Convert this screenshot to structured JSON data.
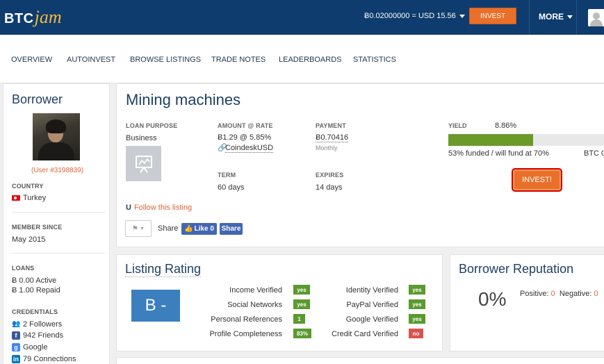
{
  "header": {
    "logo_btc": "BTC",
    "logo_jam": "jam",
    "rate": "Ƀ0.02000000 = USD 15.56",
    "invest_label": "INVEST",
    "more_label": "MORE"
  },
  "nav": {
    "items": [
      "OVERVIEW",
      "AUTOINVEST",
      "BROWSE LISTINGS",
      "TRADE NOTES",
      "LEADERBOARDS",
      "STATISTICS"
    ]
  },
  "borrower": {
    "title": "Borrower",
    "user": "(User #3198839)",
    "country_label": "COUNTRY",
    "country": "Turkey",
    "member_since_label": "MEMBER SINCE",
    "member_since": "May 2015",
    "loans_label": "LOANS",
    "loans_active": "Ƀ 0.00 Active",
    "loans_repaid": "Ƀ 1.00 Repaid",
    "credentials_label": "CREDENTIALS",
    "credentials": [
      "2 Followers",
      "942 Friends",
      "Google",
      "79 Connections"
    ]
  },
  "loan": {
    "title": "Mining machines",
    "purpose_label": "LOAN PURPOSE",
    "purpose": "Business",
    "amount_label": "AMOUNT @ RATE",
    "amount": "Ƀ1.29 @ 5.85%",
    "currency_link": "CoindeskUSD",
    "payment_label": "PAYMENT",
    "payment": "Ƀ0.70416",
    "payment_freq": "Monthly",
    "term_label": "TERM",
    "term": "60 days",
    "expires_label": "EXPIRES",
    "expires": "14 days",
    "follow": "Follow this listing",
    "share": "Share",
    "fb_like": "Like 0",
    "fb_share": "Share",
    "yield_label": "YIELD",
    "yield": "8.86%",
    "funded_fraction": 0.53,
    "funded_text": "53% funded / will fund at 70%",
    "btc_right": "BTC 0",
    "invest_button": "INVEST!"
  },
  "rating": {
    "title": "Listing Rating",
    "grade": "B -",
    "left": [
      {
        "label": "Income Verified",
        "value": "yes"
      },
      {
        "label": "Social Networks",
        "value": "yes"
      },
      {
        "label": "Personal References",
        "value": "1"
      },
      {
        "label": "Profile Completeness",
        "value": "83%"
      }
    ],
    "right": [
      {
        "label": "Identity Verified",
        "value": "yes"
      },
      {
        "label": "PayPal Verified",
        "value": "yes"
      },
      {
        "label": "Google Verified",
        "value": "yes"
      },
      {
        "label": "Credit Card Verified",
        "value": "no"
      }
    ]
  },
  "reputation": {
    "title": "Borrower Reputation",
    "percent": "0%",
    "positive_label": "Positive:",
    "positive": "0",
    "negative_label": "Negative:",
    "negative": "0"
  },
  "colors": {
    "header_bg": "#0e3c6e",
    "accent_orange": "#e8702a",
    "link_orange": "#e0643a",
    "grade_blue": "#3c7fbe",
    "badge_green": "#5a9a2e",
    "badge_red": "#d9534f"
  }
}
